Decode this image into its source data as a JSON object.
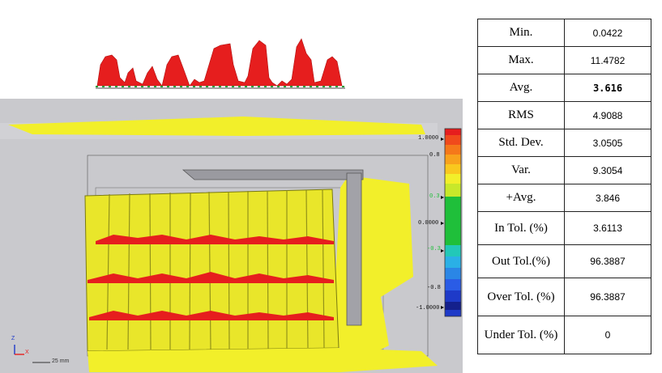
{
  "stats": [
    {
      "label": "Min.",
      "value": "0.0422"
    },
    {
      "label": "Max.",
      "value": "11.4782"
    },
    {
      "label": "Avg.",
      "value": "3.616"
    },
    {
      "label": "RMS",
      "value": "4.9088"
    },
    {
      "label": "Std. Dev.",
      "value": "3.0505"
    },
    {
      "label": "Var.",
      "value": "9.3054"
    },
    {
      "label": "+Avg.",
      "value": "3.846"
    },
    {
      "label": "In Tol. (%)",
      "value": "3.6113"
    },
    {
      "label": "Out Tol.(%)",
      "value": "96.3887"
    },
    {
      "label": "Over Tol. (%)",
      "value": "96.3887"
    },
    {
      "label": "Under Tol. (%)",
      "value": "0"
    }
  ],
  "color_scale": {
    "labels": [
      "1.0000",
      "0.8",
      "0.3",
      "0.0000",
      "-0.3",
      "-0.8",
      "-1.0000"
    ]
  },
  "viewport": {
    "scale_bar": "25 mm",
    "axes": {
      "x": "X",
      "z": "Z"
    }
  },
  "colors": {
    "deviation_high": "#e61e1e",
    "surface": "#f2ef2a",
    "in_tolerance": "#1fbf3a",
    "viewport_bg": "#c8c8cc"
  }
}
